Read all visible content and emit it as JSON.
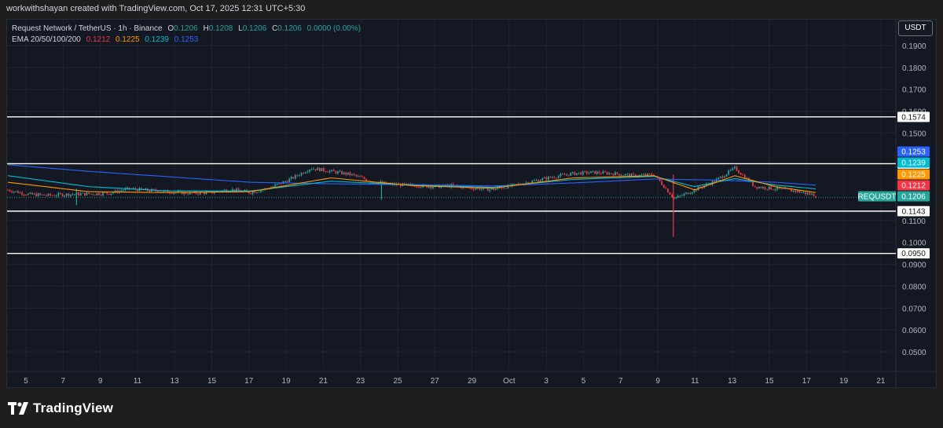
{
  "header": {
    "attribution": "workwithshayan created with TradingView.com, Oct 17, 2025 12:31 UTC+5:30"
  },
  "legend": {
    "symbol_title": "Request Network / TetherUS · 1h · Binance",
    "o_label": "O",
    "o_value": "0.1206",
    "h_label": "H",
    "h_value": "0.1208",
    "l_label": "L",
    "l_value": "0.1206",
    "c_label": "C",
    "c_value": "0.1206",
    "change": "0.0000 (0.00%)",
    "ema_label": "EMA 20/50/100/200",
    "ema20": "0.1212",
    "ema50": "0.1225",
    "ema100": "0.1239",
    "ema200": "0.1253"
  },
  "currency_button": "USDT",
  "footer": {
    "brand": "TradingView"
  },
  "colors": {
    "up": "#26a69a",
    "down": "#f23645",
    "ema20": "#f23645",
    "ema50": "#ff9800",
    "ema100": "#00bcd4",
    "ema200": "#2962ff"
  },
  "chart_data": {
    "type": "candlestick",
    "symbol": "REQUSDT",
    "ylim": [
      0.04,
      0.2
    ],
    "y_ticks": [
      "0.1900",
      "0.1800",
      "0.1700",
      "0.1600",
      "0.1500",
      "0.1100",
      "0.1000",
      "0.0900",
      "0.0800",
      "0.0700",
      "0.0600",
      "0.0500"
    ],
    "x_ticks": [
      "5",
      "7",
      "9",
      "11",
      "13",
      "15",
      "17",
      "19",
      "21",
      "23",
      "25",
      "27",
      "29",
      "Oct",
      "3",
      "5",
      "7",
      "9",
      "11",
      "13",
      "15",
      "17",
      "19",
      "21"
    ],
    "horizontal_levels": [
      "0.1574",
      "0.1360",
      "0.1143",
      "0.0950"
    ],
    "price_tags": [
      {
        "label": "0.1253",
        "value": 0.1253,
        "color": "#2962ff"
      },
      {
        "label": "0.1239",
        "value": 0.1239,
        "color": "#00bcd4"
      },
      {
        "label": "0.1225",
        "value": 0.1225,
        "color": "#ff9800"
      },
      {
        "label": "0.1212",
        "value": 0.1212,
        "color": "#f23645"
      },
      {
        "label": "0.1206",
        "value": 0.1206,
        "color": "#26a69a"
      }
    ],
    "last_price_label": "REQUSDT",
    "last_price": 0.1206,
    "price_path": [
      [
        0,
        0.124
      ],
      [
        1,
        0.122
      ],
      [
        2,
        0.1215
      ],
      [
        3,
        0.122
      ],
      [
        4,
        0.1222
      ],
      [
        5,
        0.1225
      ],
      [
        6,
        0.1245
      ],
      [
        7,
        0.1238
      ],
      [
        8,
        0.1232
      ],
      [
        9,
        0.1225
      ],
      [
        10,
        0.1228
      ],
      [
        11,
        0.1242
      ],
      [
        12,
        0.1228
      ],
      [
        13,
        0.125
      ],
      [
        14,
        0.129
      ],
      [
        15,
        0.134
      ],
      [
        16,
        0.1325
      ],
      [
        17,
        0.131
      ],
      [
        18,
        0.128
      ],
      [
        19,
        0.1265
      ],
      [
        20,
        0.1262
      ],
      [
        21,
        0.1255
      ],
      [
        22,
        0.126
      ],
      [
        23,
        0.1248
      ],
      [
        24,
        0.1242
      ],
      [
        25,
        0.126
      ],
      [
        26,
        0.128
      ],
      [
        27,
        0.13
      ],
      [
        28,
        0.1315
      ],
      [
        29,
        0.132
      ],
      [
        30,
        0.1315
      ],
      [
        31,
        0.1305
      ],
      [
        32,
        0.131
      ],
      [
        33,
        0.12
      ],
      [
        34,
        0.124
      ],
      [
        35,
        0.128
      ],
      [
        36,
        0.134
      ],
      [
        37,
        0.1255
      ],
      [
        38,
        0.1245
      ],
      [
        39,
        0.1235
      ],
      [
        40,
        0.1215
      ]
    ],
    "ema200_path": [
      [
        0,
        0.1355
      ],
      [
        4,
        0.1325
      ],
      [
        8,
        0.13
      ],
      [
        12,
        0.1275
      ],
      [
        16,
        0.1268
      ],
      [
        20,
        0.1264
      ],
      [
        24,
        0.1258
      ],
      [
        28,
        0.1272
      ],
      [
        32,
        0.129
      ],
      [
        35,
        0.1285
      ],
      [
        38,
        0.1275
      ],
      [
        40,
        0.1262
      ]
    ],
    "ema100_path": [
      [
        0,
        0.1305
      ],
      [
        4,
        0.1255
      ],
      [
        8,
        0.1235
      ],
      [
        12,
        0.1235
      ],
      [
        16,
        0.128
      ],
      [
        20,
        0.1262
      ],
      [
        24,
        0.1252
      ],
      [
        28,
        0.1288
      ],
      [
        32,
        0.1302
      ],
      [
        34,
        0.1255
      ],
      [
        36,
        0.1292
      ],
      [
        38,
        0.1262
      ],
      [
        40,
        0.1245
      ]
    ],
    "ema50_path": [
      [
        0,
        0.1275
      ],
      [
        4,
        0.1232
      ],
      [
        8,
        0.1228
      ],
      [
        12,
        0.1232
      ],
      [
        16,
        0.1295
      ],
      [
        20,
        0.126
      ],
      [
        24,
        0.1248
      ],
      [
        28,
        0.1295
      ],
      [
        32,
        0.1305
      ],
      [
        34,
        0.124
      ],
      [
        36,
        0.1305
      ],
      [
        38,
        0.1255
      ],
      [
        40,
        0.1228
      ]
    ],
    "spikes": [
      {
        "x": 3.4,
        "low": 0.117,
        "high": 0.1245
      },
      {
        "x": 18.5,
        "low": 0.1195,
        "high": 0.1265
      },
      {
        "x": 32.95,
        "low": 0.1025,
        "high": 0.131
      }
    ]
  }
}
